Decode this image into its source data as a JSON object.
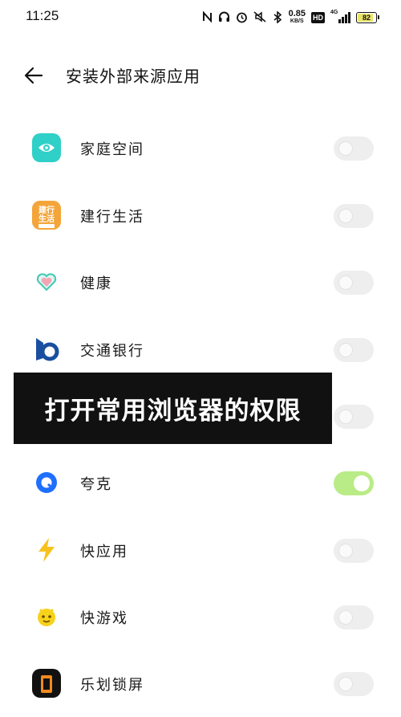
{
  "status_bar": {
    "time": "11:25",
    "net_speed_value": "0.85",
    "net_speed_unit": "KB/S",
    "hd_badge": "HD",
    "network_gen": "4G",
    "battery_level": "82",
    "icons": [
      "nfc-icon",
      "headset-icon",
      "alarm-icon",
      "mute-vibrate-icon",
      "bluetooth-icon",
      "hd-icon",
      "signal-icon",
      "battery-icon"
    ]
  },
  "header": {
    "back_icon": "arrow-left-icon",
    "title": "安装外部来源应用"
  },
  "apps": [
    {
      "label": "家庭空间",
      "icon": "eye-icon",
      "enabled": false,
      "color": "#2fd0c8"
    },
    {
      "label": "建行生活",
      "icon": "ccb-life-icon",
      "icon_text": "建行\n生活",
      "enabled": false,
      "color": "#f3a53a"
    },
    {
      "label": "健康",
      "icon": "heart-icon",
      "enabled": false,
      "color": "#42c8b4"
    },
    {
      "label": "交通银行",
      "icon": "bankcomm-icon",
      "enabled": false,
      "color": "#1a4fa0"
    },
    {
      "label": "",
      "icon": "",
      "enabled": false,
      "color": ""
    },
    {
      "label": "夸克",
      "icon": "quark-icon",
      "enabled": true,
      "color": "#1e6fff"
    },
    {
      "label": "快应用",
      "icon": "lightning-icon",
      "enabled": false,
      "color": "#f7c21b"
    },
    {
      "label": "快游戏",
      "icon": "game-face-icon",
      "enabled": false,
      "color": "#f7d21b"
    },
    {
      "label": "乐划锁屏",
      "icon": "lock-screen-icon",
      "enabled": false,
      "color": "#f28a1e"
    }
  ],
  "overlay": {
    "text": "打开常用浏览器的权限"
  },
  "colors": {
    "toggle_on": "#b9ec86",
    "toggle_off": "#eeeeee",
    "banner_bg": "#111111"
  }
}
